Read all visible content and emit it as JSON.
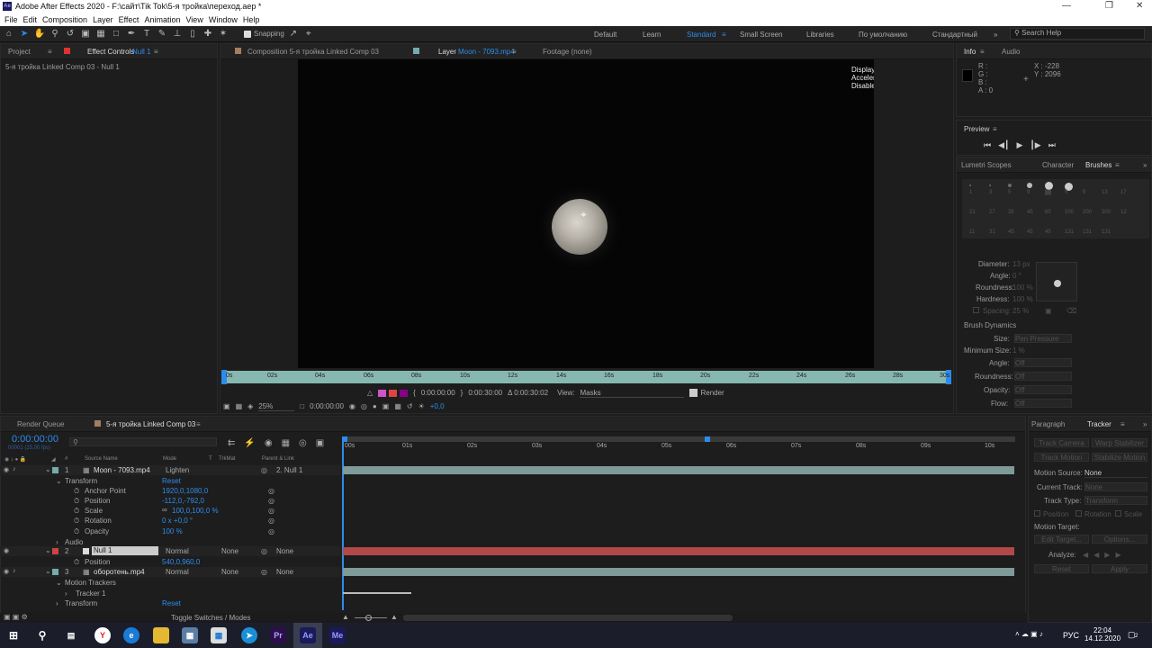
{
  "window": {
    "title": "Adobe After Effects 2020 - F:\\сайт\\Tik Tok\\5-я тройка\\переход.aep *",
    "logo": "Ae"
  },
  "menu": [
    "File",
    "Edit",
    "Composition",
    "Layer",
    "Effect",
    "Animation",
    "View",
    "Window",
    "Help"
  ],
  "toolbar": {
    "snapping": "Snapping"
  },
  "workspaces": [
    "Default",
    "Learn",
    "Standard",
    "Small Screen",
    "Libraries",
    "По умолчанию",
    "Стандартный"
  ],
  "workspace_active": "Standard",
  "search": {
    "placeholder": "Search Help"
  },
  "left_panel": {
    "tab_project": "Project",
    "tab_effect": "Effect Controls",
    "tab_effect_target": "Null 1",
    "subtitle": "5-я тройка Linked Comp 03 - Null 1"
  },
  "center_tabs": {
    "comp": "Composition 5-я тройка Linked Comp 03",
    "layer_prefix": "Layer",
    "layer_name": "Moon - 7093.mp4",
    "footage": "Footage (none)"
  },
  "viewer": {
    "notice": "Display Acceleration Disabled"
  },
  "ruler_ticks": [
    "0s",
    "02s",
    "04s",
    "06s",
    "08s",
    "10s",
    "12s",
    "14s",
    "16s",
    "18s",
    "20s",
    "22s",
    "24s",
    "26s",
    "28s",
    "30s"
  ],
  "layer_footer": {
    "in": "0:00:00:00",
    "out": "0:00:30:00",
    "duration": "Δ 0:00:30:02",
    "view_label": "View:",
    "view_value": "Masks",
    "render": "Render"
  },
  "viewer_footer": {
    "zoom": "25%",
    "time": "0:00:00:00",
    "exposure": "+0,0"
  },
  "info": {
    "tab": "Info",
    "tab2": "Audio",
    "r": "R :",
    "g": "G :",
    "b": "B :",
    "a": "A :  0",
    "x": "X : -228",
    "y": "Y : 2096"
  },
  "preview": {
    "title": "Preview"
  },
  "brushes": {
    "tabs": [
      "Lumetri Scopes",
      "Character",
      "Brushes"
    ],
    "sizes": [
      "1",
      "3",
      "5",
      "9",
      "19",
      "5",
      "9",
      "13",
      "17",
      "21",
      "27",
      "35",
      "45",
      "65",
      "100",
      "200",
      "300",
      "12",
      "11",
      "31",
      "45",
      "45",
      "45",
      "131",
      "131",
      "131"
    ],
    "labels": {
      "diameter": "Diameter:",
      "angle": "Angle:",
      "roundness": "Roundness:",
      "hardness": "Hardness:",
      "spacing": "Spacing:",
      "dynamics": "Brush Dynamics",
      "size": "Size:",
      "min_size": "Minimum Size:",
      "dyn_angle": "Angle:",
      "dyn_roundness": "Roundness:",
      "opacity": "Opacity:",
      "flow": "Flow:"
    },
    "values": {
      "diameter": "13 px",
      "angle": "0 °",
      "roundness": "100 %",
      "hardness": "100 %",
      "spacing": "25 %",
      "size": "Pen Pressure",
      "min_size": "1 %",
      "dyn_angle": "Off",
      "dyn_roundness": "Off",
      "opacity": "Off",
      "flow": "Off"
    }
  },
  "timeline": {
    "tab_render": "Render Queue",
    "tab_comp": "5-я тройка Linked Comp 03",
    "timecode": "0:00:00:00",
    "fps": "00001 (25.00 fps)",
    "headers": {
      "num": "#",
      "source": "Source Name",
      "mode": "Mode",
      "t": "T",
      "trkmat": "TrkMat",
      "parent": "Parent & Link"
    },
    "ticks": [
      "00s",
      "01s",
      "02s",
      "03s",
      "04s",
      "05s",
      "06s",
      "07s",
      "08s",
      "09s",
      "10s"
    ],
    "rows": [
      {
        "num": "1",
        "name": "Moon - 7093.mp4",
        "mode": "Lighten",
        "trk": "",
        "parent": "2. Null 1"
      },
      {
        "label": "Transform",
        "reset": "Reset"
      },
      {
        "label": "Anchor Point",
        "value": "1920,0,1080,0"
      },
      {
        "label": "Position",
        "value": "-112,0,-792,0"
      },
      {
        "label": "Scale",
        "value": "100,0,100,0 %"
      },
      {
        "label": "Rotation",
        "value": "0 x +0,0 °"
      },
      {
        "label": "Opacity",
        "value": "100 %"
      },
      {
        "label": "Audio"
      },
      {
        "num": "2",
        "name": "Null 1",
        "mode": "Normal",
        "trk": "None",
        "parent": "None"
      },
      {
        "label": "Position",
        "value": "540,0,960,0"
      },
      {
        "num": "3",
        "name": "оборотень.mp4",
        "mode": "Normal",
        "trk": "None",
        "parent": "None"
      },
      {
        "label": "Motion Trackers"
      },
      {
        "label": "Tracker 1"
      },
      {
        "label": "Transform",
        "reset": "Reset"
      }
    ],
    "footer": "Toggle Switches / Modes"
  },
  "tracker": {
    "tab_para": "Paragraph",
    "tab_tracker": "Tracker",
    "track_camera": "Track Camera",
    "warp_stab": "Warp Stabilizer",
    "track_motion": "Track Motion",
    "stab_motion": "Stabilize Motion",
    "motion_source": "Motion Source:",
    "motion_source_val": "None",
    "current_track": "Current Track:",
    "current_track_val": "None",
    "track_type": "Track Type:",
    "track_type_val": "Transform",
    "position": "Position",
    "rotation": "Rotation",
    "scale": "Scale",
    "motion_target": "Motion Target:",
    "edit_target": "Edit Target...",
    "options": "Options...",
    "analyze": "Analyze:",
    "reset": "Reset",
    "apply": "Apply"
  },
  "taskbar": {
    "time": "22:04",
    "date": "14.12.2020",
    "lang": "РУС",
    "notif": "2",
    "apps": [
      "Pr",
      "Ae",
      "Me"
    ]
  }
}
